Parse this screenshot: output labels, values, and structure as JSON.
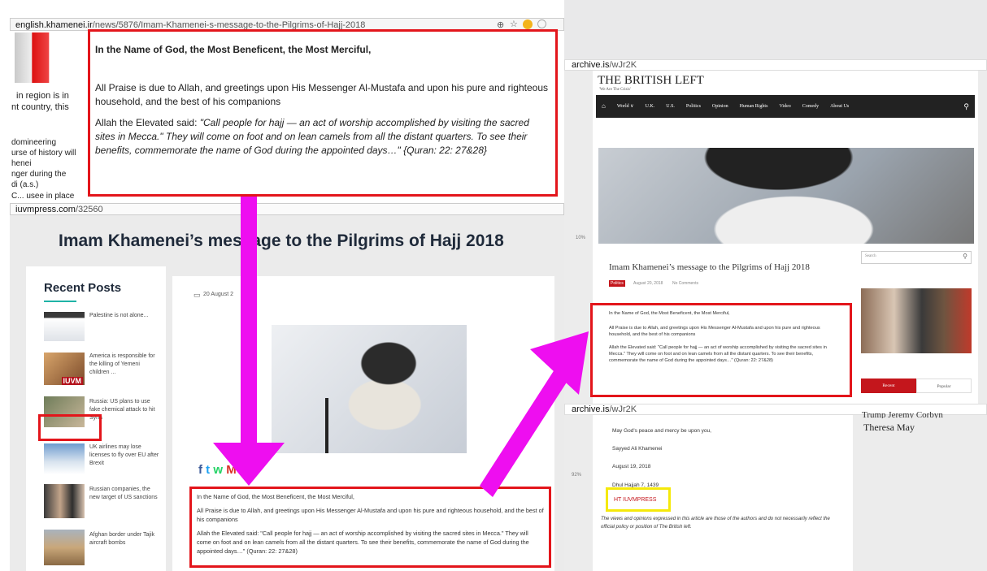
{
  "left_window": {
    "url_domain": "english.khamenei.ir",
    "url_path": "/news/5876/Imam-Khamenei-s-message-to-the-Pilgrims-of-Hajj-2018",
    "side_fragments": [
      "in region is in",
      "nt country, this",
      "domineering",
      "urse of history will",
      "henei",
      "nger during the",
      "di (a.s.)",
      "C... usee in place"
    ],
    "quote_heading": "In the Name of God, the Most Beneficent, the Most Merciful,",
    "quote_p1": "All Praise is due to Allah, and greetings upon His Messenger Al-Mustafa and upon his pure and righteous household, and the best of his companions",
    "quote_p2_intro": "Allah the Elevated said: ",
    "quote_p2_italic": "\"Call people for hajj — an act of worship accomplished by visiting the sacred sites in Mecca.\" They will come on foot and on lean camels from all the distant quarters. To see their benefits, commemorate the name of God during the appointed days…\" {Quran: 22: 27&28}"
  },
  "iuvm_window": {
    "url_domain": "iuvmpress.com",
    "url_path": "/32560",
    "title": "Imam Khamenei’s message to the Pilgrims of Hajj 2018",
    "recent_posts_heading": "Recent Posts",
    "posts": [
      {
        "text": "Palestine is not alone..."
      },
      {
        "text": "America is responsible for the killing of Yemeni children ..."
      },
      {
        "text": "Russia: US plans to use fake chemical attack to hit Syria"
      },
      {
        "text": "UK airlines may lose licenses to fly over EU after Brexit"
      },
      {
        "text": "Russian companies, the new target of US sanctions"
      },
      {
        "text": "Afghan border under Tajik aircraft bombs"
      }
    ],
    "thumb_caption": "IUVM",
    "date": "20 August 2",
    "article_heading": "In the Name of God, the Most Beneficent, the Most Merciful,",
    "article_p1": "All Praise is due to Allah, and greetings upon His Messenger Al-Mustafa and upon his pure and righteous household, and the best of his companions",
    "article_p2": "Allah the Elevated said: \"Call people for hajj — an act of worship accomplished by visiting the sacred sites in Mecca.\" They will come on foot and on lean camels from all the distant quarters. To see their benefits, commemorate the name of God during the appointed days…\" (Quran: 22: 27&28)",
    "share_icons": [
      "f",
      "t",
      "w",
      "M",
      "<"
    ],
    "colors": {
      "facebook": "#3b5998",
      "twitter": "#1da1f2",
      "whatsapp": "#25d366",
      "gmail": "#d93025",
      "share": "#333333"
    }
  },
  "archive_top": {
    "url_domain": "archive.is",
    "url_path": "/wJr2K",
    "site_title": "THE BRITISH LEFT",
    "tagline": "'We Are The Crisis'",
    "nav_items": [
      "World ∨",
      "U.K.",
      "U.S.",
      "Politics",
      "Opinion",
      "Human Rights",
      "Video",
      "Comedy",
      "About Us"
    ],
    "home_icon": "home-icon",
    "search_icon": "search-icon",
    "zoom_label": "10%",
    "post_title": "Imam Khamenei’s message to the Pilgrims of Hajj 2018",
    "category_tag": "Politics",
    "meta_date": "August 20, 2018",
    "meta_comments": "No Comments",
    "search_placeholder": "Search",
    "body_heading": "In the Name of God, the Most Beneficent, the Most Merciful,",
    "body_p1": "All Praise is due to Allah, and greetings upon His Messenger Al-Mustafa and upon his pure and righteous household, and the best of his companions",
    "body_p2": "Allah the Elevated said: \"Call people for hajj — an act of worship accomplished by visiting the sacred sites in Mecca.\" They will come on foot and on lean camels from all the distant quarters. To see their benefits, commemorate the name of God during the appointed days…\" (Quran: 22: 27&28)",
    "tab_recent": "Recent",
    "tab_popular": "Popular",
    "accent_red": "#c4161c"
  },
  "archive_bottom": {
    "url_domain": "archive.is",
    "url_path": "/wJr2K",
    "zoom_label": "92%",
    "closing_1": "May God's peace and mercy be upon you,",
    "signature": "Sayyed Ali Khamenei",
    "date_1": "August 19, 2018",
    "date_2": "Dhul Hajjah 7, 1439",
    "ht_credit": "HT IUVMPRESS",
    "disclaimer": "The views and opinions expressed in this article are those of the authors and do not necessarily reflect the official policy or position of The British left.",
    "sidebar_cut": "Trump Jeremy Corbyn",
    "sidebar_item": "Theresa May"
  },
  "annotation_colors": {
    "highlight_red": "#e3151b",
    "highlight_yellow": "#f5e90a",
    "arrow_magenta": "#ee0ef0"
  }
}
